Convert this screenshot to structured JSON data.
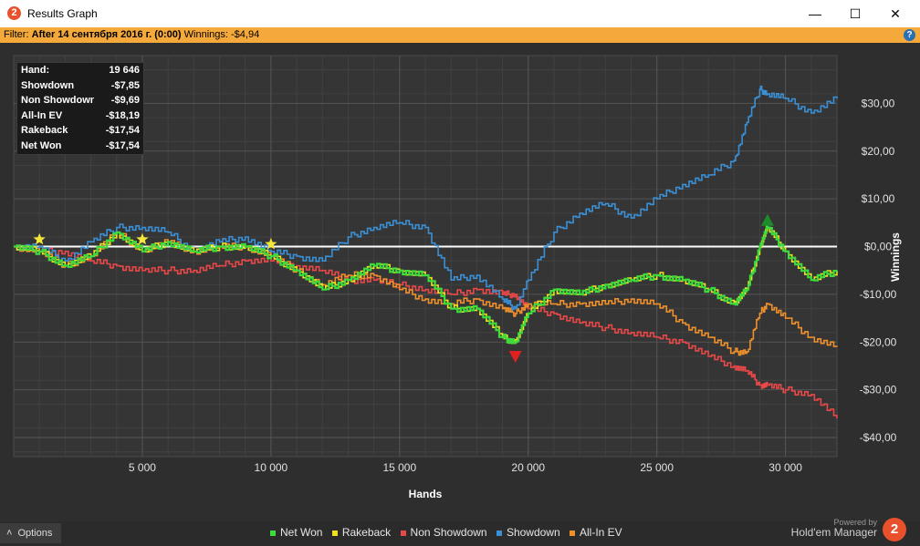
{
  "window": {
    "title": "Results Graph",
    "app_icon": "2",
    "minimize_glyph": "—",
    "maximize_glyph": "☐",
    "close_glyph": "✕"
  },
  "filter": {
    "label": "Filter:",
    "value": "After 14 сентября 2016 г. (0:00)",
    "winnings_label": "Winnings:",
    "winnings_value": "-$4,94",
    "help_glyph": "?"
  },
  "stats": [
    {
      "label": "Hand:",
      "value": "19 646"
    },
    {
      "label": "Showdown",
      "value": "-$7,85"
    },
    {
      "label": "Non Showdown",
      "value": "-$9,69"
    },
    {
      "label": "All-In EV",
      "value": "-$18,19"
    },
    {
      "label": "Rakeback",
      "value": "-$17,54"
    },
    {
      "label": "Net Won",
      "value": "-$17,54"
    }
  ],
  "chart_data": {
    "type": "line",
    "xlabel": "Hands",
    "ylabel": "Winnings",
    "xlim": [
      0,
      32000
    ],
    "ylim": [
      -44,
      40
    ],
    "x_ticks": [
      5000,
      10000,
      15000,
      20000,
      25000,
      30000
    ],
    "x_tick_labels": [
      "5 000",
      "10 000",
      "15 000",
      "20 000",
      "25 000",
      "30 000"
    ],
    "y_ticks": [
      30,
      20,
      10,
      0,
      -10,
      -20,
      -30,
      -40
    ],
    "y_tick_labels": [
      "$30,00",
      "$20,00",
      "$10,00",
      "$0,00",
      "-$10,00",
      "-$20,00",
      "-$30,00",
      "-$40,00"
    ],
    "grid": true,
    "legend_position": "bottom",
    "x": [
      0,
      1000,
      2000,
      3000,
      4000,
      5000,
      6000,
      7000,
      8000,
      9000,
      10000,
      11000,
      12000,
      13000,
      14000,
      15000,
      16000,
      17000,
      18000,
      19000,
      19500,
      20000,
      21000,
      22000,
      23000,
      24000,
      25000,
      26000,
      27000,
      28000,
      28500,
      29000,
      29300,
      30000,
      31000,
      32000
    ],
    "series": [
      {
        "name": "Net Won",
        "color": "#3ddc3d",
        "values": [
          0,
          -1,
          -4,
          -2,
          3,
          -1,
          1,
          -1,
          0,
          0,
          -2,
          -5,
          -9,
          -7,
          -4,
          -5,
          -6,
          -13,
          -13,
          -19,
          -20,
          -14,
          -9,
          -10,
          -8,
          -7,
          -6,
          -7,
          -9,
          -12,
          -9,
          0,
          4,
          -1,
          -7,
          -5
        ]
      },
      {
        "name": "Rakeback",
        "color": "#f0e020",
        "values": [
          0,
          -1,
          -4,
          -2,
          3,
          -1,
          1,
          -1,
          0,
          0,
          -2,
          -5,
          -9,
          -7,
          -4,
          -5,
          -6,
          -13,
          -13,
          -19,
          -20,
          -14,
          -9,
          -10,
          -8,
          -7,
          -6,
          -7,
          -9,
          -12,
          -9,
          0,
          4,
          -1,
          -7,
          -5
        ]
      },
      {
        "name": "Non Showdown",
        "color": "#e84848",
        "values": [
          0,
          -1,
          -1,
          -3,
          -4,
          -5,
          -5,
          -5,
          -4,
          -3,
          -3,
          -4,
          -5,
          -7,
          -7,
          -8,
          -9,
          -10,
          -9,
          -10,
          -10,
          -13,
          -14,
          -16,
          -17,
          -18,
          -19,
          -20,
          -23,
          -25,
          -26,
          -29,
          -29,
          -30,
          -31,
          -36
        ]
      },
      {
        "name": "Showdown",
        "color": "#3b8fd4",
        "values": [
          0,
          0,
          -3,
          1,
          4,
          4,
          3,
          -1,
          1,
          2,
          -1,
          -2,
          -3,
          2,
          4,
          5,
          4,
          -7,
          -6,
          -11,
          -13,
          -7,
          3,
          7,
          9,
          6,
          10,
          13,
          15,
          18,
          26,
          33,
          32,
          31,
          28,
          31
        ]
      },
      {
        "name": "All-In EV",
        "color": "#f0902a",
        "values": [
          0,
          -1,
          -4,
          -2,
          3,
          -1,
          1,
          -1,
          0,
          0,
          -2,
          -5,
          -8,
          -6,
          -6,
          -9,
          -11,
          -12,
          -11,
          -13,
          -14,
          -12,
          -12,
          -12,
          -12,
          -11,
          -12,
          -16,
          -19,
          -22,
          -22,
          -14,
          -12,
          -15,
          -19,
          -21
        ]
      }
    ],
    "markers": [
      {
        "type": "star",
        "x": 1000,
        "y": 1.5,
        "color": "#f5e63a"
      },
      {
        "type": "star",
        "x": 5000,
        "y": 1.5,
        "color": "#f5e63a"
      },
      {
        "type": "star",
        "x": 10000,
        "y": 0.5,
        "color": "#f5e63a"
      },
      {
        "type": "triangle-up",
        "x": 29300,
        "y": 5.5,
        "color": "#1f8a2a"
      },
      {
        "type": "triangle-down",
        "x": 19500,
        "y": -23,
        "color": "#e02020"
      }
    ]
  },
  "legend": [
    {
      "label": "Net Won",
      "color": "#3ddc3d"
    },
    {
      "label": "Rakeback",
      "color": "#f0e020"
    },
    {
      "label": "Non Showdown",
      "color": "#e84848"
    },
    {
      "label": "Showdown",
      "color": "#3b8fd4"
    },
    {
      "label": "All-In EV",
      "color": "#f0902a"
    }
  ],
  "footer": {
    "options_label": "Options",
    "options_glyph": "˄",
    "powered_by": "Powered by",
    "brand_name": "Hold'em Manager",
    "brand_logo": "2"
  }
}
